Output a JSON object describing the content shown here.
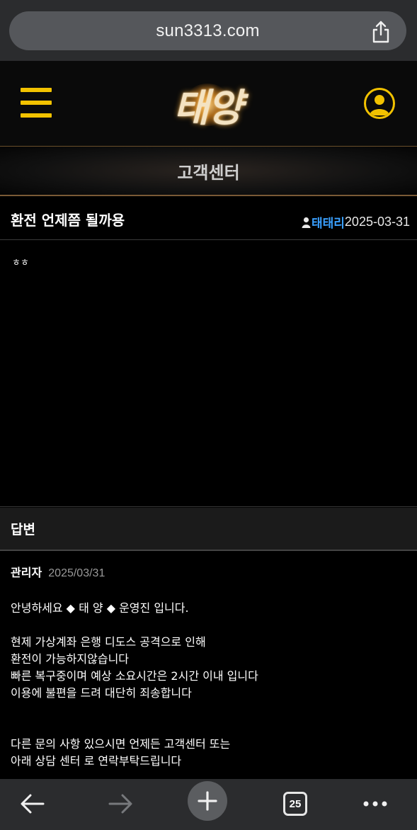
{
  "browser": {
    "url": "sun3313.com",
    "tab_count": "25"
  },
  "header": {
    "logo_alt": "태양"
  },
  "section": {
    "title": "고객센터"
  },
  "post": {
    "title": "환전 언제쯤 될까용",
    "author": "태태리",
    "date": "2025-03-31",
    "content": "ㅎㅎ"
  },
  "answer": {
    "heading": "답변",
    "author": "관리자",
    "date": "2025/03/31",
    "lines": [
      "안녕하세요 ◆ 태 양 ◆ 운영진 입니다.",
      "",
      "현제 가상계좌 은행 디도스 공격으로 인해",
      "환전이 가능하지않습니다",
      "빠른 복구중이며 예상 소요시간은 2시간 이내 입니다",
      "이용에 불편을 드려 대단히 죄송합니다",
      "",
      "",
      "다른 문의 사항 있으시면 언제든 고객센터 또는",
      "아래 상담 센터 로 연락부탁드립니다"
    ]
  },
  "colors": {
    "accent_yellow": "#f2c200",
    "author_blue": "#3aa0ff",
    "divider_gold": "#7a5a36"
  },
  "icons": [
    "share-icon",
    "hamburger-menu-icon",
    "user-icon",
    "person-icon",
    "back-arrow-icon",
    "forward-arrow-icon",
    "plus-icon",
    "tabs-icon",
    "more-icon"
  ]
}
